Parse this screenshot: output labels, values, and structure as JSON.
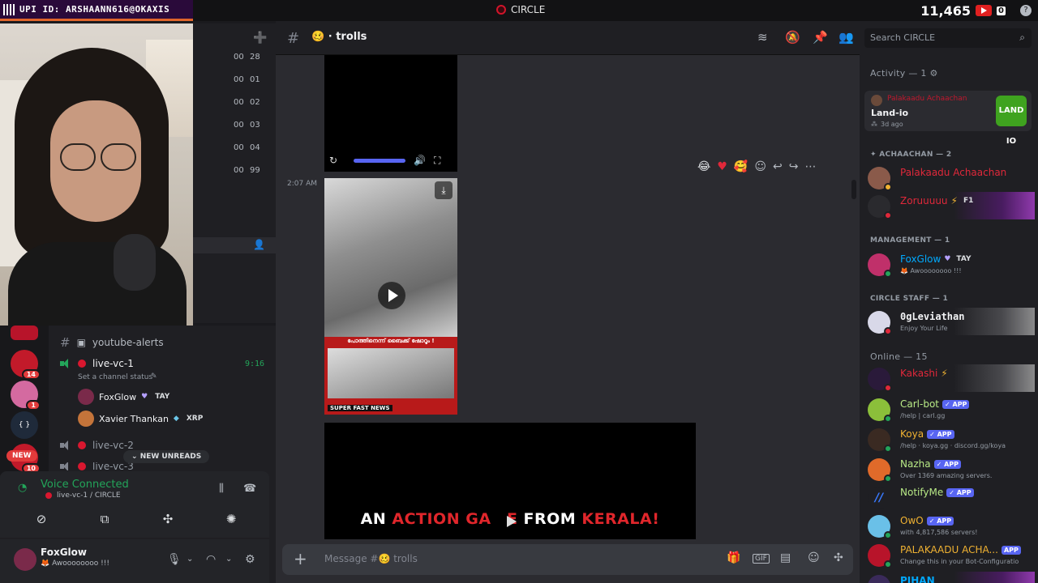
{
  "overlay": {
    "upi": "UPI ID: ARSHAANN616@OKAXIS",
    "stream_title": "CIRCLE",
    "viewer_count": "11,465",
    "viewer_badge": "0"
  },
  "channel_numbers": [
    {
      "a": "00",
      "b": "28"
    },
    {
      "a": "00",
      "b": "01"
    },
    {
      "a": "00",
      "b": "02"
    },
    {
      "a": "00",
      "b": "03"
    },
    {
      "a": "00",
      "b": "04"
    },
    {
      "a": "00",
      "b": "99"
    }
  ],
  "servers": {
    "badges": [
      "14",
      "1",
      "10"
    ],
    "new_label": "NEW"
  },
  "channels": {
    "youtube_alerts": "youtube-alerts",
    "live_vc_1": "live-vc-1",
    "live_vc_1_time": "9:16",
    "set_status": "Set a channel status",
    "live_vc_2": "live-vc-2",
    "live_vc_3": "live-vc-3",
    "new_unreads": "NEW UNREADS",
    "vc_users": [
      {
        "name": "FoxGlow",
        "tag": "TAY"
      },
      {
        "name": "Xavier Thankan",
        "tag": "XRP"
      }
    ]
  },
  "voice": {
    "title": "Voice Connected",
    "subtitle": "live-vc-1 / CIRCLE"
  },
  "user": {
    "name": "FoxGlow",
    "status": "Awoooooooo !!!"
  },
  "chat": {
    "channel_name": "trolls",
    "timestamp": "2:07 AM",
    "video2_header": "പോത്തിനെന്ന് ബൈക്ക് ഷോറൂം !",
    "video2_footer": "SUPER FAST NEWS",
    "video3_text_a": "AN ",
    "video3_text_b": "ACTION GA",
    "video3_text_c": "E ",
    "video3_text_d": "FROM ",
    "video3_text_e": "KERALA!",
    "message_placeholder": "Message #🥴 trolls"
  },
  "members": {
    "search_placeholder": "Search CIRCLE",
    "activity_label": "Activity — 1",
    "activity": {
      "by": "Palakaadu Achaachan",
      "game": "Land-io",
      "ago": "3d ago",
      "icon_text": "LAND IO"
    },
    "sections": {
      "achaachan": "ACHAACHAN — 2",
      "management": "MANAGEMENT — 1",
      "staff": "CIRCLE STAFF — 1",
      "online": "Online — 15"
    },
    "list": [
      {
        "name": "Palakaadu Achaachan",
        "status": "",
        "color": "#e0283a",
        "badge": ""
      },
      {
        "name": "Zoruuuuu",
        "status": "",
        "color": "#e0283a",
        "badge": "F1"
      },
      {
        "name": "FoxGlow",
        "status": "Awoooooooo !!!",
        "color": "#00a8fc",
        "badge": "TAY"
      },
      {
        "name": "0gLeviathan",
        "status": "Enjoy Your Life",
        "color": "#f2f3f5",
        "badge": ""
      },
      {
        "name": "Kakashi",
        "status": "",
        "color": "#e0283a",
        "badge": ""
      },
      {
        "name": "Carl-bot",
        "status": "/help | carl.gg",
        "color": "#b8e986",
        "badge": "APP"
      },
      {
        "name": "Koya",
        "status": "/help · koya.gg · discord.gg/koya",
        "color": "#f0b232",
        "badge": "APP"
      },
      {
        "name": "Nazha",
        "status": "Over 1369 amazing servers.",
        "color": "#b8e986",
        "badge": "APP"
      },
      {
        "name": "NotifyMe",
        "status": "",
        "color": "#b8e986",
        "badge": "APP"
      },
      {
        "name": "OwO",
        "status": "with 4,817,586 servers!",
        "color": "#f0b232",
        "badge": "APP"
      },
      {
        "name": "PALAKAADU ACHA...",
        "status": "Change this in your Bot-Configuratio",
        "color": "#f0b232",
        "badge": "APP"
      },
      {
        "name": "PIHAN",
        "status": "",
        "color": "#00a8fc",
        "badge": ""
      }
    ]
  }
}
